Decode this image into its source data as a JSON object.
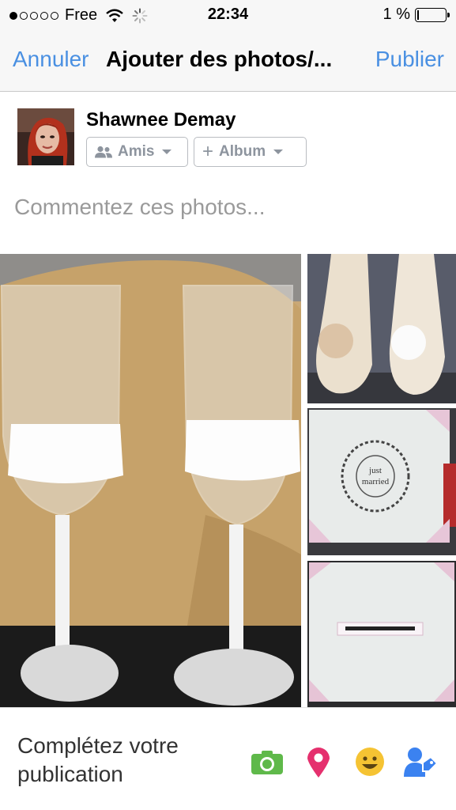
{
  "status_bar": {
    "carrier": "Free",
    "time": "22:34",
    "battery": "1 %",
    "signal_bars_filled": 1,
    "signal_bars_total": 5,
    "battery_level": 0.01
  },
  "nav": {
    "cancel_label": "Annuler",
    "title": "Ajouter des photos/...",
    "publish_label": "Publier"
  },
  "composer": {
    "user_name": "Shawnee Demay",
    "audience_label": "Amis",
    "album_label": "Album",
    "comment_placeholder": "Commentez ces photos..."
  },
  "photos": {
    "album_caption_line1": "just",
    "album_caption_line2": "married"
  },
  "footer": {
    "prompt": "Complétez votre publication",
    "icons": [
      "camera-icon",
      "location-pin-icon",
      "feeling-smiley-icon",
      "tag-people-icon"
    ]
  },
  "colors": {
    "accent": "#4a90e2",
    "camera": "#5fb94a",
    "location": "#e5306e",
    "feeling": "#f5c333",
    "tag": "#3b82f0"
  }
}
